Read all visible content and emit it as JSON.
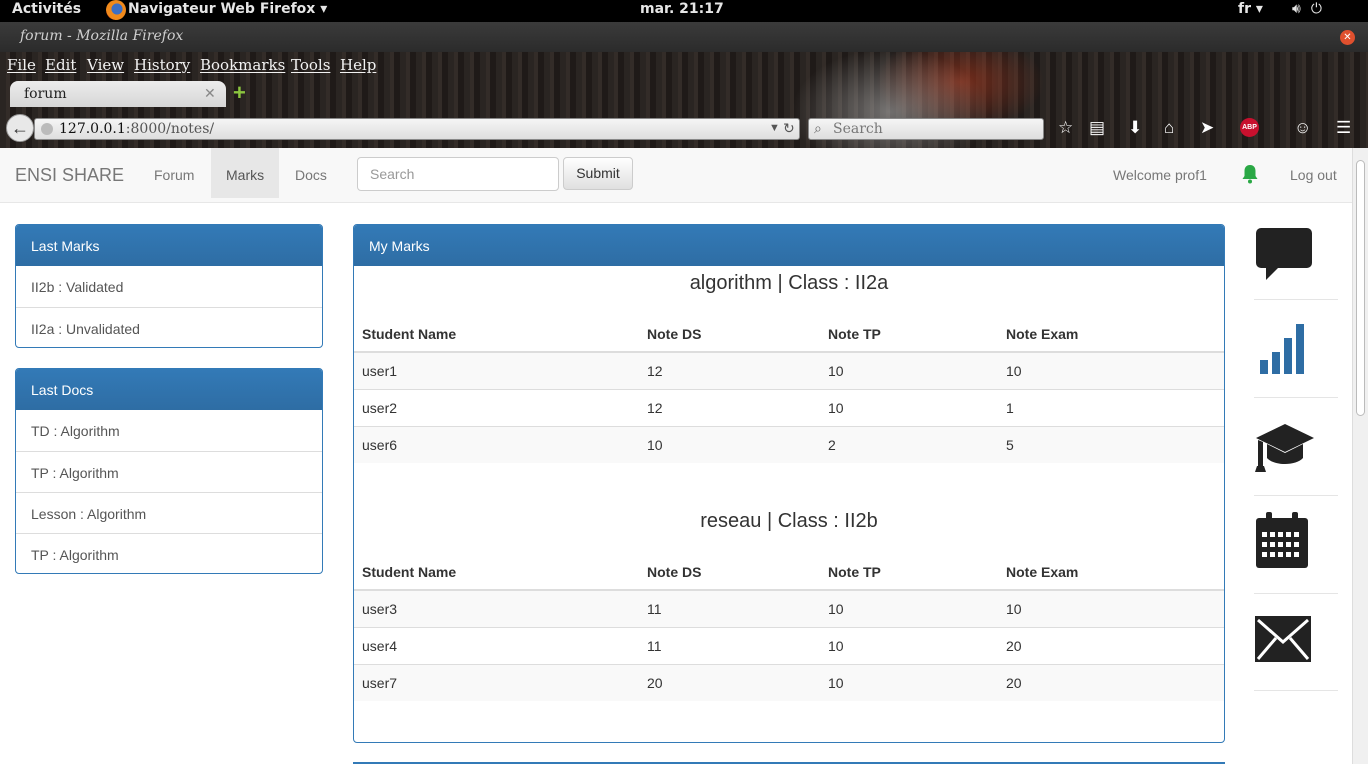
{
  "desktop": {
    "activities": "Activités",
    "app_name": "Navigateur Web Firefox ▾",
    "clock": "mar. 21:17",
    "lang": "fr ▾"
  },
  "window": {
    "title": "forum - Mozilla Firefox"
  },
  "browser": {
    "menu": [
      "File",
      "Edit",
      "View",
      "History",
      "Bookmarks",
      "Tools",
      "Help"
    ],
    "tab_title": "forum",
    "url_host": "127.0.0.1",
    "url_rest": ":8000/notes/",
    "search_placeholder": "Search",
    "abp_label": "ABP"
  },
  "site": {
    "brand": "ENSI SHARE",
    "nav": [
      "Forum",
      "Marks",
      "Docs"
    ],
    "active_nav": "Marks",
    "search_placeholder": "Search",
    "submit_label": "Submit",
    "welcome": "Welcome prof1",
    "logout": "Log out",
    "accent_color": "#337ab7",
    "bell_color": "#2aa845"
  },
  "sidebar": {
    "last_marks": {
      "title": "Last Marks",
      "items": [
        "II2b : Validated",
        "II2a : Unvalidated"
      ]
    },
    "last_docs": {
      "title": "Last Docs",
      "items": [
        "TD : Algorithm",
        "TP : Algorithm",
        "Lesson : Algorithm",
        "TP : Algorithm"
      ]
    }
  },
  "main": {
    "title": "My Marks",
    "columns": [
      "Student Name",
      "Note DS",
      "Note TP",
      "Note Exam"
    ],
    "sections": [
      {
        "heading": "algorithm | Class : II2a",
        "rows": [
          [
            "user1",
            "12",
            "10",
            "10"
          ],
          [
            "user2",
            "12",
            "10",
            "1"
          ],
          [
            "user6",
            "10",
            "2",
            "5"
          ]
        ]
      },
      {
        "heading": "reseau | Class : II2b",
        "rows": [
          [
            "user3",
            "11",
            "10",
            "10"
          ],
          [
            "user4",
            "11",
            "10",
            "20"
          ],
          [
            "user7",
            "20",
            "10",
            "20"
          ]
        ]
      }
    ]
  },
  "rail_icons": [
    "chat-icon",
    "bar-chart-icon",
    "graduation-cap-icon",
    "calendar-icon",
    "envelope-icon"
  ]
}
